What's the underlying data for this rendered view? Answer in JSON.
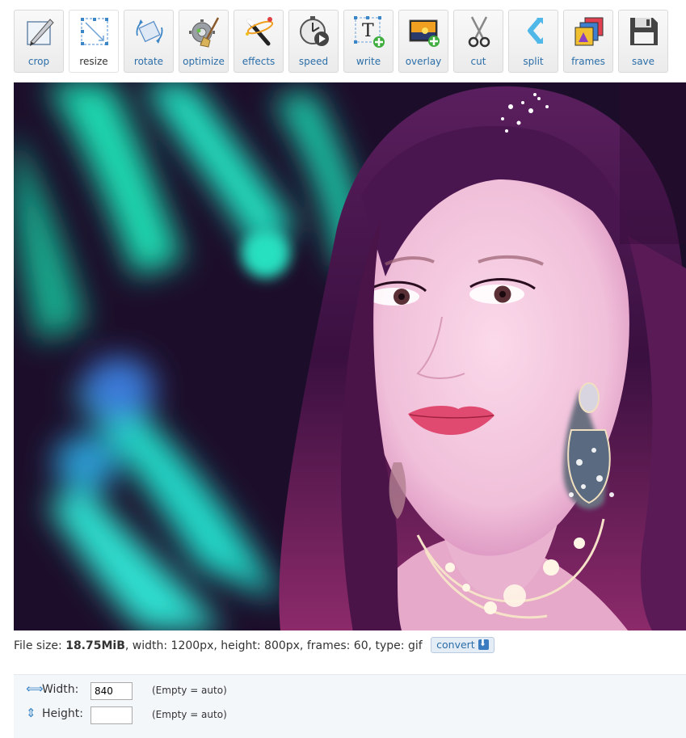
{
  "toolbar": {
    "items": [
      {
        "label": "crop",
        "icon": "crop-icon",
        "active": false
      },
      {
        "label": "resize",
        "icon": "resize-icon",
        "active": true
      },
      {
        "label": "rotate",
        "icon": "rotate-icon",
        "active": false
      },
      {
        "label": "optimize",
        "icon": "optimize-icon",
        "active": false
      },
      {
        "label": "effects",
        "icon": "effects-icon",
        "active": false
      },
      {
        "label": "speed",
        "icon": "speed-icon",
        "active": false
      },
      {
        "label": "write",
        "icon": "write-icon",
        "active": false
      },
      {
        "label": "overlay",
        "icon": "overlay-icon",
        "active": false
      },
      {
        "label": "cut",
        "icon": "cut-icon",
        "active": false
      },
      {
        "label": "split",
        "icon": "split-icon",
        "active": false
      },
      {
        "label": "frames",
        "icon": "frames-icon",
        "active": false
      },
      {
        "label": "save",
        "icon": "save-icon",
        "active": false
      }
    ]
  },
  "preview": {
    "content": "animated GIF frame: woman with long dark magenta-tinted hair, crystal earrings and necklace, turquoise and purple blurred background lights"
  },
  "file_info": {
    "size_prefix": "File size: ",
    "size_value": "18.75MiB",
    "details": ", width: 1200px, height: 800px, frames: 60, type: gif",
    "convert_label": "convert"
  },
  "resize_form": {
    "width_label": "Width:",
    "width_value": "840",
    "width_hint": "(Empty = auto)",
    "height_label": "Height:",
    "height_value": "",
    "height_hint": "(Empty = auto)"
  },
  "colors": {
    "link": "#2b6ea8",
    "panel_bg": "#f4f7fa",
    "accent_icon": "#3b86c7"
  }
}
